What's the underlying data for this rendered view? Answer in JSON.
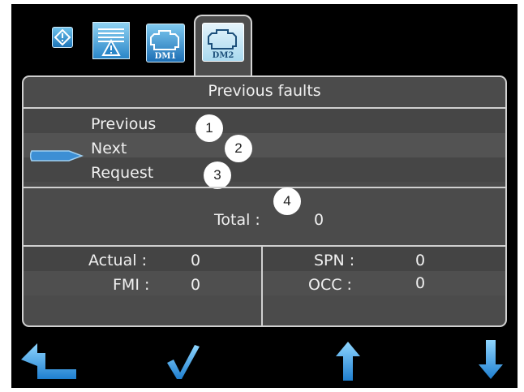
{
  "tabs": {
    "dm1_label": "DM1",
    "dm2_label": "DM2"
  },
  "panel": {
    "title": "Previous faults",
    "menu": [
      {
        "label": "Previous",
        "marker": "1"
      },
      {
        "label": "Next",
        "marker": "2"
      },
      {
        "label": "Request",
        "marker": "3"
      }
    ],
    "total": {
      "label": "Total :",
      "value": "0",
      "marker": "4"
    },
    "actual": {
      "label": "Actual :",
      "value": "0"
    },
    "spn": {
      "label": "SPN :",
      "value": "0"
    },
    "fmi": {
      "label": "FMI :",
      "value": "0"
    },
    "occ": {
      "label": "OCC :",
      "value": "0"
    }
  },
  "softkeys": [
    "back-arrow-icon",
    "checkmark-icon",
    "up-arrow-icon",
    "down-arrow-icon"
  ],
  "colors": {
    "screen_bg": "#000000",
    "panel_bg": "#4b4b4b",
    "accent_blue": "#2a8fd8",
    "text": "#f0f0f0"
  }
}
